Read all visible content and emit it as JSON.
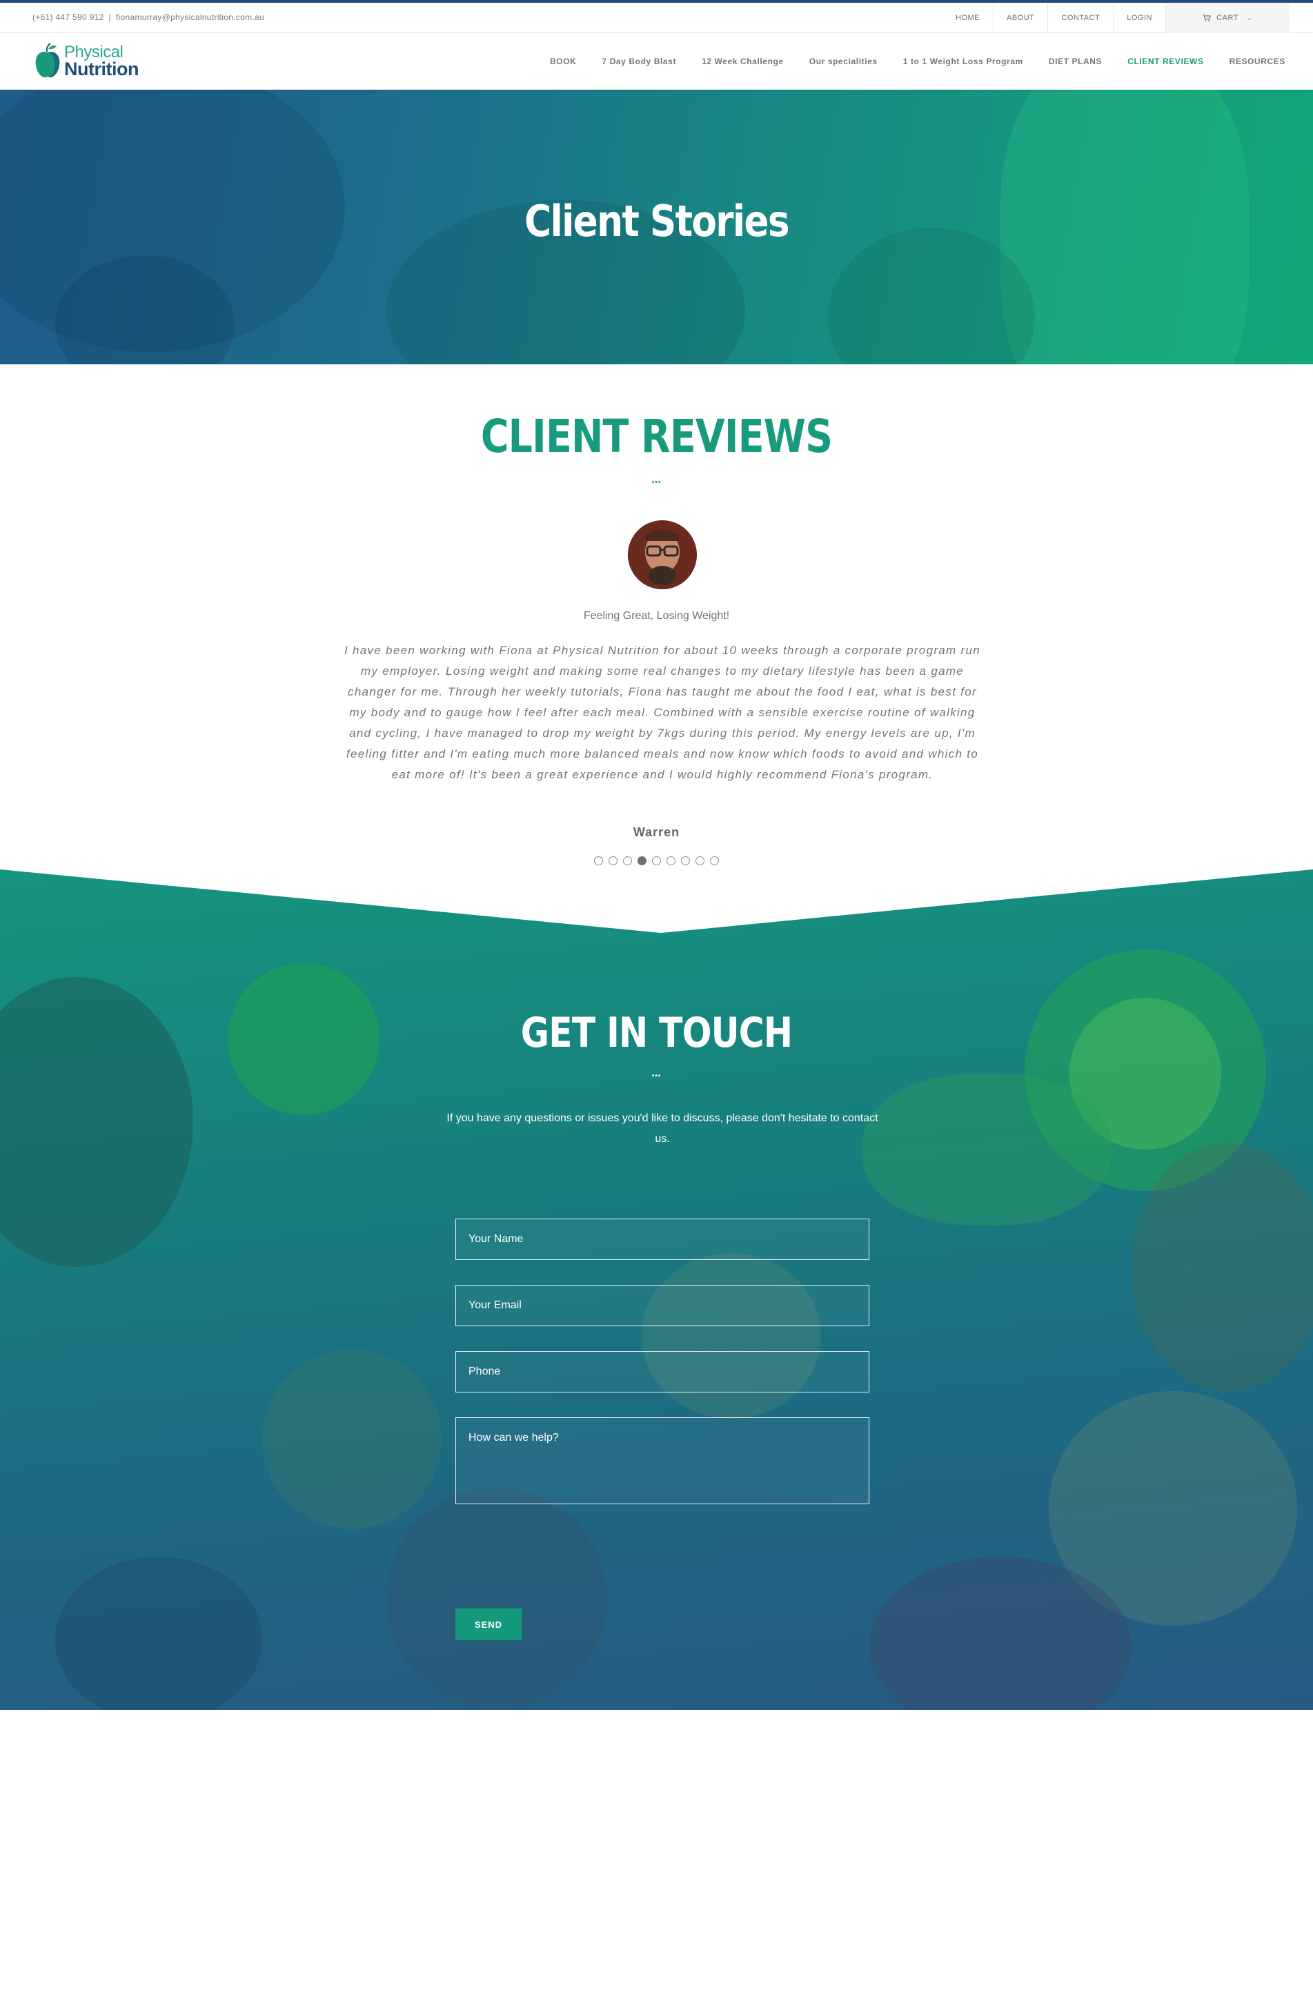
{
  "topbar": {
    "phone": "(+61) 447 590 912",
    "separator": "|",
    "email": "fionamurray@physicalnutrition.com.au",
    "links": [
      "HOME",
      "ABOUT",
      "CONTACT",
      "LOGIN"
    ],
    "cart_label": "CART"
  },
  "logo": {
    "line1": "Physical",
    "line2": "Nutrition"
  },
  "nav": {
    "items": [
      "BOOK",
      "7 Day Body Blast",
      "12 Week Challenge",
      "Our specialities",
      "1 to 1 Weight Loss Program",
      "DIET PLANS",
      "CLIENT REVIEWS",
      "RESOURCES"
    ],
    "active": "CLIENT REVIEWS"
  },
  "hero": {
    "title": "Client Stories"
  },
  "reviews": {
    "heading": "CLIENT REVIEWS",
    "separator": "•••",
    "title": "Feeling Great, Losing Weight!",
    "text": "I have been working with Fiona at Physical Nutrition for about 10 weeks through a corporate program run my employer.  Losing weight and making some real changes to my dietary lifestyle has been a game changer for me.  Through her weekly tutorials, Fiona has taught me about the food I eat, what is best for my body and to gauge how I feel after each meal.  Combined with a sensible exercise routine of walking and cycling, I have managed to drop my weight by 7kgs during this period.  My energy levels are up, I'm feeling fitter and I'm eating much more balanced meals and now know which foods to avoid and which to eat more of!  It's been a great experience and I would highly recommend Fiona's program.",
    "author": "Warren",
    "pager_count": 9,
    "pager_active": 4
  },
  "contact": {
    "heading": "GET IN TOUCH",
    "separator": "•••",
    "intro": "If you have any questions or issues you'd like to discuss, please don't hesitate to contact us.",
    "name_placeholder": "Your Name",
    "email_placeholder": "Your Email",
    "phone_placeholder": "Phone",
    "message_placeholder": "How can we help?",
    "send_label": "SEND"
  },
  "colors": {
    "brand_green": "#179a7e",
    "brand_blue": "#1f4e79",
    "topbar_border": "#1f4e79"
  },
  "icons": {
    "cart": "cart-icon",
    "cart_dropdown": "chevron-down-icon",
    "logo": "apple-logo-icon"
  }
}
